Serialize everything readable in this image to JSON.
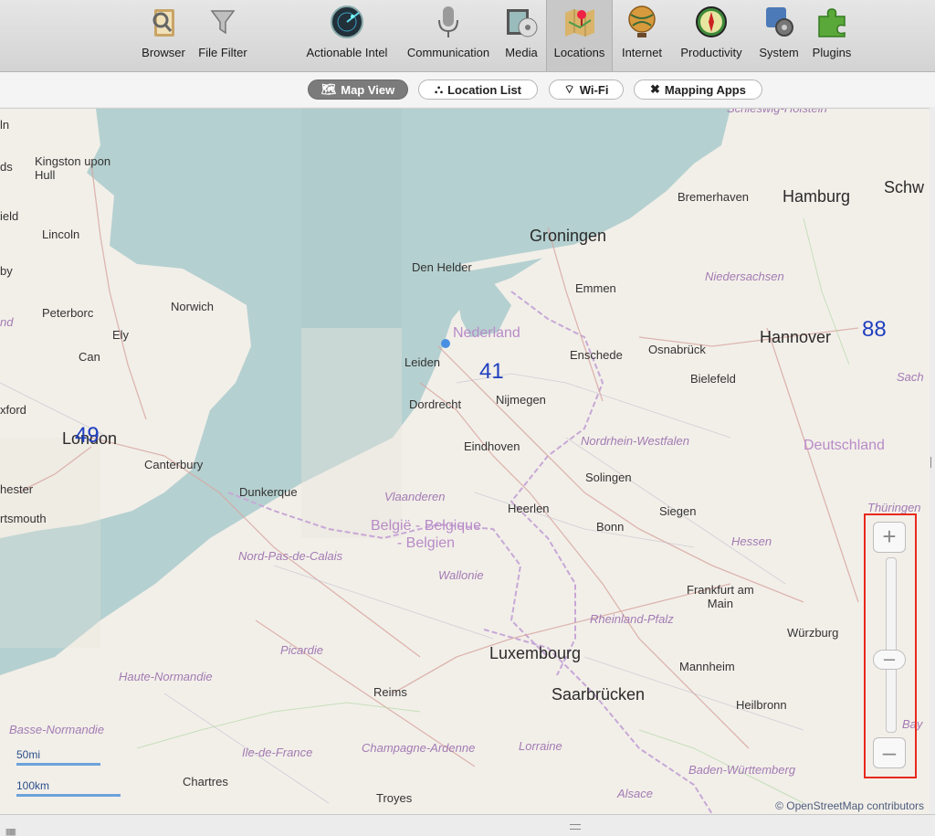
{
  "toolbar": {
    "items": [
      {
        "label": "Browser",
        "icon": "browser-icon"
      },
      {
        "label": "File Filter",
        "icon": "funnel-icon"
      },
      {
        "label": "Actionable Intel",
        "icon": "radar-icon"
      },
      {
        "label": "Communication",
        "icon": "microphone-icon"
      },
      {
        "label": "Media",
        "icon": "media-icon"
      },
      {
        "label": "Locations",
        "icon": "map-pin-icon"
      },
      {
        "label": "Internet",
        "icon": "globe-icon"
      },
      {
        "label": "Productivity",
        "icon": "compass-icon"
      },
      {
        "label": "System",
        "icon": "system-icon"
      },
      {
        "label": "Plugins",
        "icon": "puzzle-icon"
      }
    ],
    "active": "Locations"
  },
  "tabs": {
    "map_view": "Map View",
    "location_list": "Location List",
    "wifi": "Wi-Fi",
    "mapping_apps": "Mapping Apps"
  },
  "map": {
    "clusters": [
      "49",
      "41",
      "88"
    ],
    "cities": {
      "kingston": "Kingston upon\nHull",
      "lincoln": "Lincoln",
      "peterborough": "Peterborc",
      "norwich": "Norwich",
      "ely": "Ely",
      "cambridge": "Can",
      "oxford": "xford",
      "london": "London",
      "canterbury": "Canterbury",
      "chester": "hester",
      "portsmouth": "rtsmouth",
      "dunkerque": "Dunkerque",
      "groningen": "Groningen",
      "den_helder": "Den Helder",
      "emmen": "Emmen",
      "leiden": "Leiden",
      "dordrecht": "Dordrecht",
      "nijmegen": "Nijmegen",
      "enschede": "Enschede",
      "osnabruck": "Osnabrück",
      "bielefeld": "Bielefeld",
      "hannover": "Hannover",
      "bremerhaven": "Bremerhaven",
      "hamburg": "Hamburg",
      "schw": "Schw",
      "eindhoven": "Eindhoven",
      "solingen": "Solingen",
      "heerlen": "Heerlen",
      "bonn": "Bonn",
      "siegen": "Siegen",
      "frankfurt": "Frankfurt am\nMain",
      "wurzburg": "Würzburg",
      "luxembourg": "Luxembourg",
      "mannheim": "Mannheim",
      "saarbrucken": "Saarbrücken",
      "heilbronn": "Heilbronn",
      "reims": "Reims",
      "chartres": "Chartres",
      "troyes": "Troyes",
      "baden": "Baden-Württemberg"
    },
    "regions": {
      "nederland": "Nederland",
      "niedersachsen": "Niedersachsen",
      "nrw": "Nordrhein-Westfalen",
      "deutschland": "Deutschland",
      "vlaanderen": "Vlaanderen",
      "belgie": "België - Belgique\n- Belgien",
      "wallonie": "Wallonie",
      "nord_pas": "Nord-Pas-de-Calais",
      "hessen": "Hessen",
      "rheinland": "Rheinland-Pfalz",
      "picardie": "Picardie",
      "haute_normandie": "Haute-Normandie",
      "basse_normandie": "Basse-Normandie",
      "ile_de_france": "Ile-de-France",
      "champagne": "Champagne-Ardenne",
      "lorraine": "Lorraine",
      "alsace": "Alsace",
      "thuringen": "Thüringen",
      "sachsen": "Sach",
      "bay": "Bay",
      "schleswig": "Schleswig-Holstein",
      "ln": "ln",
      "ds": "ds",
      "field": "ield",
      "by": "by",
      "nd": "nd"
    },
    "scale_mi": "50mi",
    "scale_km": "100km",
    "attribution": "© OpenStreetMap contributors",
    "zoom_level": 0.6
  }
}
